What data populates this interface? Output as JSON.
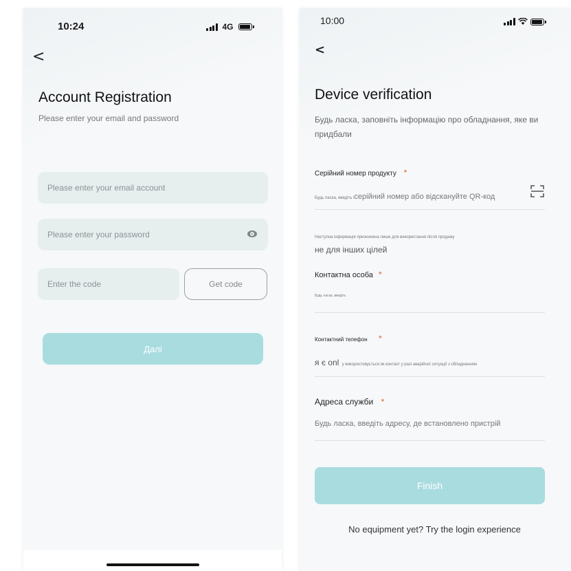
{
  "left_screen": {
    "status": {
      "time": "10:24",
      "network": "4G"
    },
    "icons": {
      "signal": "signal-icon",
      "battery": "battery-icon",
      "back": "back-chevron-icon",
      "eye": "eye-icon"
    },
    "back_glyph": "<",
    "title": "Account Registration",
    "subtitle": "Please enter your email and password",
    "email_placeholder": "Please enter your email account",
    "password_placeholder": "Please enter your password",
    "code_placeholder": "Enter the code",
    "get_code_label": "Get code",
    "next_label": "Далі"
  },
  "right_screen": {
    "status": {
      "time": "10:00"
    },
    "icons": {
      "signal": "signal-icon",
      "wifi": "wifi-icon",
      "battery": "battery-icon",
      "back": "back-chevron-icon",
      "scan": "scan-icon"
    },
    "back_glyph": "<",
    "title": "Device verification",
    "subtitle": "Будь ласка, заповніть інформацію про обладнання, яке ви придбали",
    "serial": {
      "label": "Серійний номер продукту",
      "required": "*",
      "hint_small": "Будь ласка, введіть і",
      "hint_large": "серійний номер або відскануйте QR-код"
    },
    "info_note_line1": "Наступна інформація призначена лише для використання після продажу",
    "info_note_line2": "не для інших цілей",
    "contact": {
      "label": "Контактна особа",
      "required": "*",
      "hint": "Будь ласка, введіть"
    },
    "phone": {
      "label": "Контактний телефон",
      "required": "*",
      "hint_prefix": "я є onl",
      "hint_rest": "у використовується як контакт у разі аварійної ситуації з обладнанням"
    },
    "address": {
      "label": "Адреса служби",
      "required": "*",
      "hint": "Будь ласка, введіть адресу, де встановлено пристрій"
    },
    "finish_label": "Finish",
    "try_login": "No equipment yet? Try the login experience"
  },
  "colors": {
    "button_teal": "#a9dcdf",
    "field_bg": "#e6eeee",
    "required_star": "#e0622c"
  }
}
